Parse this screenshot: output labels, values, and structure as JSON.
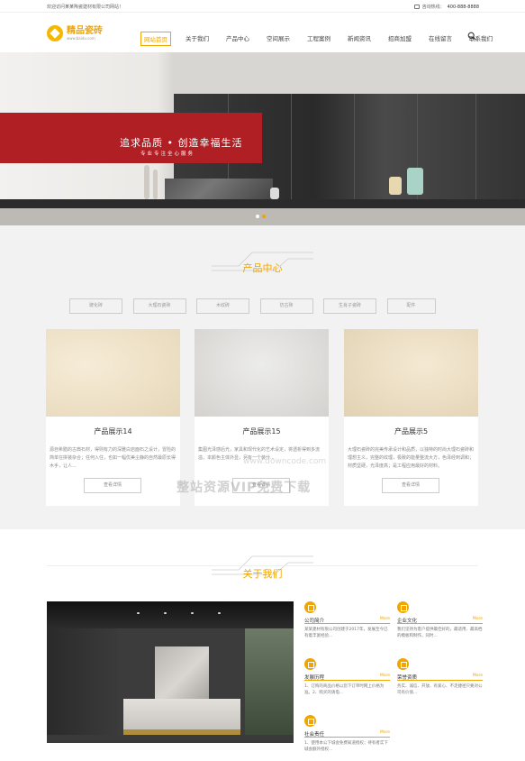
{
  "topbar": {
    "welcome": "欢迎访问某某陶瓷建材有限公司网站！",
    "hotline_label": "咨询热线：",
    "hotline_number": "400-888-8888"
  },
  "header": {
    "logo_name": "精品瓷砖",
    "logo_url": "www.baidu.com",
    "nav": [
      "网站首页",
      "关于我们",
      "产品中心",
      "空间展示",
      "工程案例",
      "新闻资讯",
      "招商加盟",
      "在线留言",
      "联系我们"
    ],
    "active_nav": "网站首页"
  },
  "banner": {
    "slogan": "追求品质 • 创造幸福生活",
    "subslogan": "专业专注全心服务",
    "slides": 2,
    "current_slide": 2
  },
  "products": {
    "title": "产品中心",
    "categories": [
      "玻化砖",
      "大理石瓷砖",
      "木纹砖",
      "仿古砖",
      "生肖子瓷砖",
      "配件"
    ],
    "cards": [
      {
        "title": "产品展示14",
        "desc": "源自希腊的古典石材，得则有力的深雅白岩面石之设计，冒险的简单在拼装杂合；任何入住，也如一幅优美尘静的自然最原长得木手，让人...",
        "button": "查看详情",
        "color": "#ece1c8"
      },
      {
        "title": "产品展示15",
        "desc": "集图光泽感后光，家具和现代化的艺术设定，将透析得到多流溢，本颜色主体外显，另有一个装什...",
        "button": "查看详情",
        "color": "#dedcda"
      },
      {
        "title": "产品展示5",
        "desc": "大理石瓷砖的完美传承设计和品质，以独特的时尚大理石瓷砖和理想主义，完整的纹理，极致的能量整流大方，色泽经到调和；材质坚硬，光泽度高；是工程应用最好的材料。",
        "button": "查看详情",
        "color": "#ebdfc6"
      }
    ]
  },
  "watermark": {
    "text": "整站资源VIP免费下载",
    "url": "www.downcode.com"
  },
  "about": {
    "title": "关于我们",
    "items": [
      {
        "name": "公司简介",
        "more": "More",
        "desc": "某某建材有限公司创建于2017年，发展至今已有着丰富经验..."
      },
      {
        "name": "企业文化",
        "more": "More",
        "desc": "我们坚持为客户提供最佳好的，最适用、最高档的模板和制作，同时..."
      },
      {
        "name": "发展历程",
        "more": "More",
        "desc": "1、订购的商品价格以您下订单时网上价格为准。2、购买的请电..."
      },
      {
        "name": "荣誉资质",
        "more": "More",
        "desc": "务实、诚信、开放、有爱心、不走捷径只要对公司有价值..."
      },
      {
        "name": "社会责任",
        "more": "More",
        "desc": "1、使用本公下城会免费知道授权；待有者实下城会额外授权..."
      }
    ]
  },
  "colors": {
    "accent": "#f0a500",
    "banner_red": "#b01f24",
    "section_bg": "#f2f2f2"
  }
}
